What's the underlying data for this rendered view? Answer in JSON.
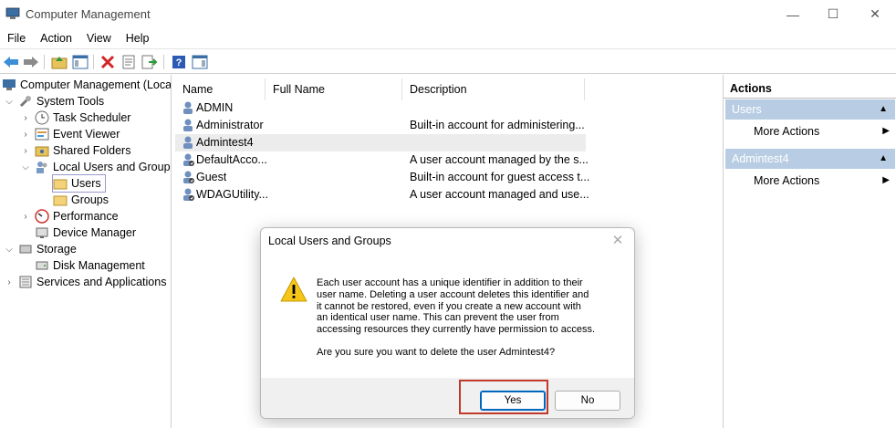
{
  "window": {
    "title": "Computer Management"
  },
  "menu": [
    "File",
    "Action",
    "View",
    "Help"
  ],
  "tree": {
    "root": "Computer Management (Local",
    "system_tools": "System Tools",
    "task_scheduler": "Task Scheduler",
    "event_viewer": "Event Viewer",
    "shared_folders": "Shared Folders",
    "local_users_groups": "Local Users and Groups",
    "users": "Users",
    "groups": "Groups",
    "performance": "Performance",
    "device_manager": "Device Manager",
    "storage": "Storage",
    "disk_management": "Disk Management",
    "services_apps": "Services and Applications"
  },
  "list": {
    "columns": [
      "Name",
      "Full Name",
      "Description"
    ],
    "rows": [
      {
        "name": "ADMIN",
        "full_name": "",
        "description": ""
      },
      {
        "name": "Administrator",
        "full_name": "",
        "description": "Built-in account for administering..."
      },
      {
        "name": "Admintest4",
        "full_name": "",
        "description": ""
      },
      {
        "name": "DefaultAcco...",
        "full_name": "",
        "description": "A user account managed by the s..."
      },
      {
        "name": "Guest",
        "full_name": "",
        "description": "Built-in account for guest access t..."
      },
      {
        "name": "WDAGUtility...",
        "full_name": "",
        "description": "A user account managed and use..."
      }
    ]
  },
  "actions": {
    "header": "Actions",
    "group1": "Users",
    "group1_item": "More Actions",
    "group2": "Admintest4",
    "group2_item": "More Actions"
  },
  "dialog": {
    "title": "Local Users and Groups",
    "close": "✕",
    "message_lines": [
      "Each user account has a unique identifier in addition to their",
      "user name. Deleting a user account deletes this identifier and",
      "it cannot be restored, even if you create a new account with",
      "an identical user name. This can prevent the user from",
      "accessing resources they currently have permission to access."
    ],
    "question": "Are you sure you want to delete the user Admintest4?",
    "yes": "Yes",
    "no": "No"
  },
  "colors": {
    "accent": "#0067c0",
    "group_bg": "#b8cde3",
    "highlight_box": "#c0392b"
  }
}
